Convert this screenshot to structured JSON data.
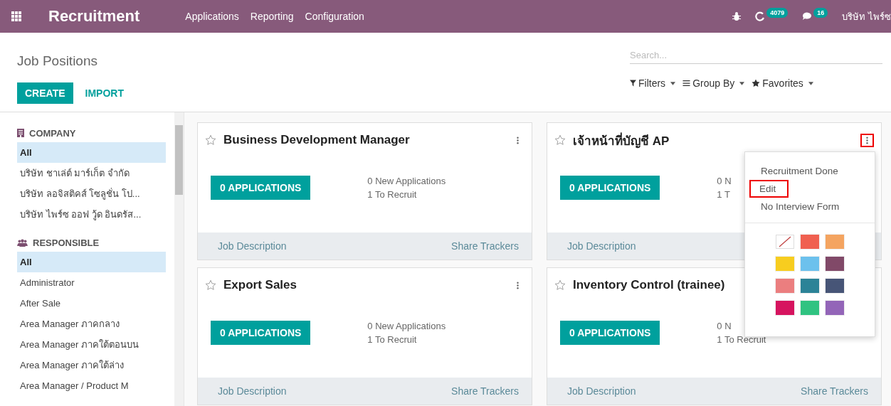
{
  "navbar": {
    "app_name": "Recruitment",
    "menu": [
      "Applications",
      "Reporting",
      "Configuration"
    ],
    "activity_count": "4079",
    "message_count": "16",
    "company": "บริษัท ไพร์ซ"
  },
  "control_panel": {
    "title": "Job Positions",
    "buttons": [
      "CREATE",
      "IMPORT"
    ],
    "search": {
      "placeholder": "Search..."
    },
    "filters": [
      "Filters",
      "Group By",
      "Favorites"
    ]
  },
  "sidebar": {
    "sections": [
      {
        "kind": "company",
        "title": "COMPANY",
        "items": [
          {
            "label": "All",
            "selected": true
          },
          {
            "label": "บริษัท ชาเล่ต์ มาร์เก็ต จำกัด",
            "selected": false
          },
          {
            "label": "บริษัท ลอจิสติคส์ โซลูชั่น โป...",
            "selected": false
          },
          {
            "label": "บริษัท ไพร์ซ ออฟ วู้ด อินดรัส...",
            "selected": false
          }
        ]
      },
      {
        "kind": "responsible",
        "title": "RESPONSIBLE",
        "items": [
          {
            "label": "All",
            "selected": true
          },
          {
            "label": "Administrator",
            "selected": false
          },
          {
            "label": "After Sale",
            "selected": false
          },
          {
            "label": "Area Manager ภาคกลาง",
            "selected": false
          },
          {
            "label": "Area Manager ภาคใต้ตอนบน",
            "selected": false
          },
          {
            "label": "Area Manager ภาคใต้ล่าง",
            "selected": false
          },
          {
            "label": "Area Manager / Product M",
            "selected": false
          }
        ]
      }
    ]
  },
  "cards": [
    {
      "title": "Business Development Manager",
      "applications": "0 APPLICATIONS",
      "stats": [
        "0 New Applications",
        "1 To Recruit"
      ],
      "footer": [
        "Job Description",
        "Share Trackers"
      ],
      "menu_button": true,
      "menu_highlighted": false
    },
    {
      "title": "เจ้าหน้าที่บัญชี AP",
      "applications": "0 APPLICATIONS",
      "stats": [
        "0 N",
        "1 T"
      ],
      "footer": [
        "Job Description"
      ],
      "menu_button": true,
      "menu_highlighted": true
    },
    {
      "title": "Export Sales",
      "applications": "0 APPLICATIONS",
      "stats": [
        "0 New Applications",
        "1 To Recruit"
      ],
      "footer": [
        "Job Description",
        "Share Trackers"
      ],
      "menu_button": true,
      "menu_highlighted": false
    },
    {
      "title": "Inventory Control (trainee)",
      "applications": "0 APPLICATIONS",
      "stats": [
        "0 N",
        "1 To Recruit"
      ],
      "footer": [
        "Job Description",
        "Share Trackers"
      ],
      "menu_button": false
    }
  ],
  "dropdown": {
    "items": [
      {
        "label": "Recruitment Done",
        "highlighted": false
      },
      {
        "label": "Edit",
        "highlighted": true
      },
      {
        "label": "No Interview Form",
        "highlighted": false
      }
    ],
    "colors": [
      {
        "kind": "none"
      },
      {
        "kind": "swatch",
        "color": "#f06050"
      },
      {
        "kind": "swatch",
        "color": "#f4a460"
      },
      {
        "kind": "swatch",
        "color": "#f7cd1f"
      },
      {
        "kind": "swatch",
        "color": "#6cc1ed"
      },
      {
        "kind": "swatch",
        "color": "#814968"
      },
      {
        "kind": "swatch",
        "color": "#eb7e7f"
      },
      {
        "kind": "swatch",
        "color": "#2c8397"
      },
      {
        "kind": "swatch",
        "color": "#475577"
      },
      {
        "kind": "swatch",
        "color": "#d6145f"
      },
      {
        "kind": "swatch",
        "color": "#30c381"
      },
      {
        "kind": "swatch",
        "color": "#9365b8"
      }
    ]
  }
}
